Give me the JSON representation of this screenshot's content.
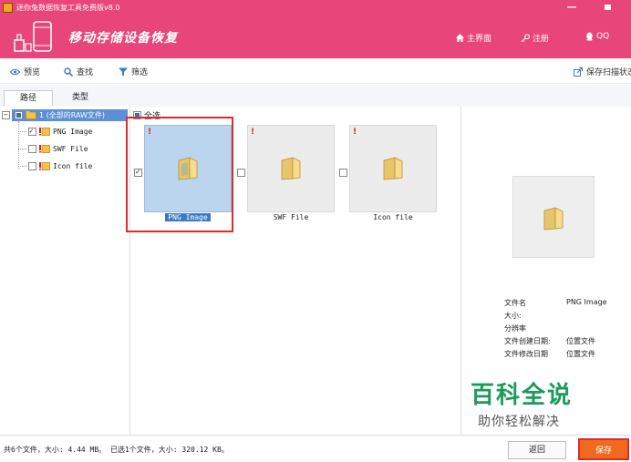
{
  "window": {
    "title": "迷你兔数据恢复工具免费版v8.0",
    "minimize_glyph": "—"
  },
  "header": {
    "title": "移动存储设备恢复",
    "nav": [
      {
        "label": "主界面",
        "icon": "home-icon"
      },
      {
        "label": "注册",
        "icon": "key-icon"
      },
      {
        "label": "QQ",
        "icon": "qq-icon"
      }
    ]
  },
  "toolbar": {
    "preview": "预览",
    "search": "查找",
    "filter": "筛选",
    "save_state": "保存扫描状态"
  },
  "tabs": [
    {
      "label": "路径",
      "active": true
    },
    {
      "label": "类型",
      "active": false
    }
  ],
  "tree": {
    "root": {
      "expander": "−",
      "label": "1 (全部的RAW文件)"
    },
    "items": [
      {
        "label": "PNG Image",
        "checked": true
      },
      {
        "label": "SWF File",
        "checked": false
      },
      {
        "label": "Icon file",
        "checked": false
      }
    ]
  },
  "main": {
    "select_all": "全选",
    "files": [
      {
        "name": "PNG Image",
        "checked": true,
        "selected": true,
        "warning": "!"
      },
      {
        "name": "SWF File",
        "checked": false,
        "selected": false,
        "warning": "!"
      },
      {
        "name": "Icon file",
        "checked": false,
        "selected": false,
        "warning": "!"
      }
    ]
  },
  "preview": {
    "fields": [
      {
        "label": "文件名",
        "value": "PNG Image"
      },
      {
        "label": "大小:",
        "value": ""
      },
      {
        "label": "分辨率",
        "value": ""
      },
      {
        "label": "文件创建日期:",
        "value": "位置文件"
      },
      {
        "label": "文件修改日期",
        "value": "位置文件"
      }
    ]
  },
  "watermark": {
    "title": "百科全说",
    "subtitle": "助你轻松解决"
  },
  "status": {
    "text": "共6个文件，大小: 4.44 MB。 已选1个文件，大小: 320.12 KB。",
    "back_button": "返回",
    "save_button": "保存"
  },
  "colors": {
    "brand": "#e8457a",
    "selection": "#bcd5ee",
    "save_button": "#f06a1e",
    "highlight_box": "#e02a2a"
  }
}
